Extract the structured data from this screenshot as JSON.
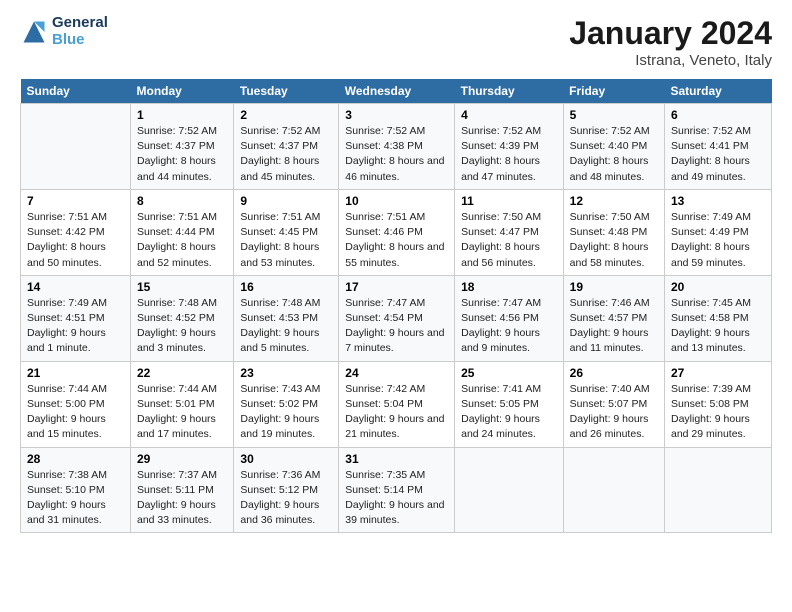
{
  "header": {
    "logo_line1": "General",
    "logo_line2": "Blue",
    "month_title": "January 2024",
    "location": "Istrana, Veneto, Italy"
  },
  "days_of_week": [
    "Sunday",
    "Monday",
    "Tuesday",
    "Wednesday",
    "Thursday",
    "Friday",
    "Saturday"
  ],
  "weeks": [
    [
      {
        "day": "",
        "sunrise": "",
        "sunset": "",
        "daylight": ""
      },
      {
        "day": "1",
        "sunrise": "7:52 AM",
        "sunset": "4:37 PM",
        "daylight": "8 hours and 44 minutes."
      },
      {
        "day": "2",
        "sunrise": "7:52 AM",
        "sunset": "4:37 PM",
        "daylight": "8 hours and 45 minutes."
      },
      {
        "day": "3",
        "sunrise": "7:52 AM",
        "sunset": "4:38 PM",
        "daylight": "8 hours and 46 minutes."
      },
      {
        "day": "4",
        "sunrise": "7:52 AM",
        "sunset": "4:39 PM",
        "daylight": "8 hours and 47 minutes."
      },
      {
        "day": "5",
        "sunrise": "7:52 AM",
        "sunset": "4:40 PM",
        "daylight": "8 hours and 48 minutes."
      },
      {
        "day": "6",
        "sunrise": "7:52 AM",
        "sunset": "4:41 PM",
        "daylight": "8 hours and 49 minutes."
      }
    ],
    [
      {
        "day": "7",
        "sunrise": "7:51 AM",
        "sunset": "4:42 PM",
        "daylight": "8 hours and 50 minutes."
      },
      {
        "day": "8",
        "sunrise": "7:51 AM",
        "sunset": "4:44 PM",
        "daylight": "8 hours and 52 minutes."
      },
      {
        "day": "9",
        "sunrise": "7:51 AM",
        "sunset": "4:45 PM",
        "daylight": "8 hours and 53 minutes."
      },
      {
        "day": "10",
        "sunrise": "7:51 AM",
        "sunset": "4:46 PM",
        "daylight": "8 hours and 55 minutes."
      },
      {
        "day": "11",
        "sunrise": "7:50 AM",
        "sunset": "4:47 PM",
        "daylight": "8 hours and 56 minutes."
      },
      {
        "day": "12",
        "sunrise": "7:50 AM",
        "sunset": "4:48 PM",
        "daylight": "8 hours and 58 minutes."
      },
      {
        "day": "13",
        "sunrise": "7:49 AM",
        "sunset": "4:49 PM",
        "daylight": "8 hours and 59 minutes."
      }
    ],
    [
      {
        "day": "14",
        "sunrise": "7:49 AM",
        "sunset": "4:51 PM",
        "daylight": "9 hours and 1 minute."
      },
      {
        "day": "15",
        "sunrise": "7:48 AM",
        "sunset": "4:52 PM",
        "daylight": "9 hours and 3 minutes."
      },
      {
        "day": "16",
        "sunrise": "7:48 AM",
        "sunset": "4:53 PM",
        "daylight": "9 hours and 5 minutes."
      },
      {
        "day": "17",
        "sunrise": "7:47 AM",
        "sunset": "4:54 PM",
        "daylight": "9 hours and 7 minutes."
      },
      {
        "day": "18",
        "sunrise": "7:47 AM",
        "sunset": "4:56 PM",
        "daylight": "9 hours and 9 minutes."
      },
      {
        "day": "19",
        "sunrise": "7:46 AM",
        "sunset": "4:57 PM",
        "daylight": "9 hours and 11 minutes."
      },
      {
        "day": "20",
        "sunrise": "7:45 AM",
        "sunset": "4:58 PM",
        "daylight": "9 hours and 13 minutes."
      }
    ],
    [
      {
        "day": "21",
        "sunrise": "7:44 AM",
        "sunset": "5:00 PM",
        "daylight": "9 hours and 15 minutes."
      },
      {
        "day": "22",
        "sunrise": "7:44 AM",
        "sunset": "5:01 PM",
        "daylight": "9 hours and 17 minutes."
      },
      {
        "day": "23",
        "sunrise": "7:43 AM",
        "sunset": "5:02 PM",
        "daylight": "9 hours and 19 minutes."
      },
      {
        "day": "24",
        "sunrise": "7:42 AM",
        "sunset": "5:04 PM",
        "daylight": "9 hours and 21 minutes."
      },
      {
        "day": "25",
        "sunrise": "7:41 AM",
        "sunset": "5:05 PM",
        "daylight": "9 hours and 24 minutes."
      },
      {
        "day": "26",
        "sunrise": "7:40 AM",
        "sunset": "5:07 PM",
        "daylight": "9 hours and 26 minutes."
      },
      {
        "day": "27",
        "sunrise": "7:39 AM",
        "sunset": "5:08 PM",
        "daylight": "9 hours and 29 minutes."
      }
    ],
    [
      {
        "day": "28",
        "sunrise": "7:38 AM",
        "sunset": "5:10 PM",
        "daylight": "9 hours and 31 minutes."
      },
      {
        "day": "29",
        "sunrise": "7:37 AM",
        "sunset": "5:11 PM",
        "daylight": "9 hours and 33 minutes."
      },
      {
        "day": "30",
        "sunrise": "7:36 AM",
        "sunset": "5:12 PM",
        "daylight": "9 hours and 36 minutes."
      },
      {
        "day": "31",
        "sunrise": "7:35 AM",
        "sunset": "5:14 PM",
        "daylight": "9 hours and 39 minutes."
      },
      {
        "day": "",
        "sunrise": "",
        "sunset": "",
        "daylight": ""
      },
      {
        "day": "",
        "sunrise": "",
        "sunset": "",
        "daylight": ""
      },
      {
        "day": "",
        "sunrise": "",
        "sunset": "",
        "daylight": ""
      }
    ]
  ],
  "labels": {
    "sunrise_prefix": "Sunrise: ",
    "sunset_prefix": "Sunset: ",
    "daylight_prefix": "Daylight: "
  }
}
